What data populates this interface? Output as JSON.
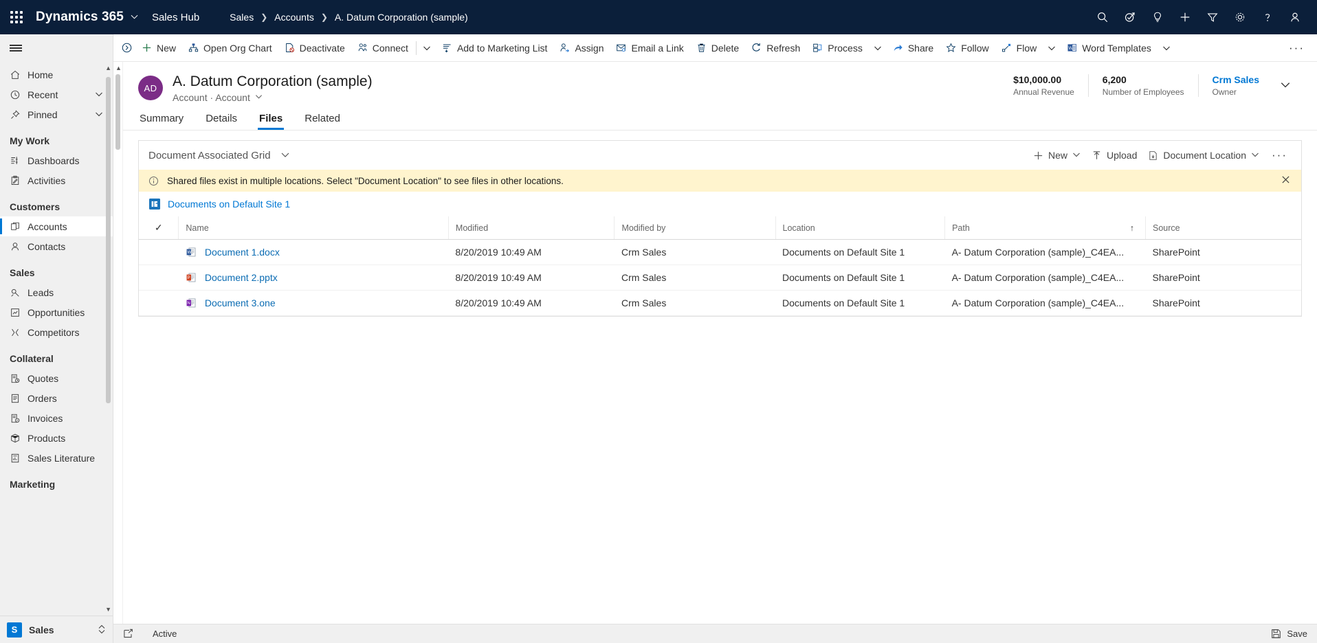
{
  "topbar": {
    "waffle_label": "app-launcher",
    "brand": "Dynamics 365",
    "app_title": "Sales Hub",
    "breadcrumbs": [
      {
        "label": "Sales"
      },
      {
        "label": "Accounts"
      },
      {
        "label": "A. Datum Corporation (sample)"
      }
    ],
    "icons": [
      {
        "name": "search-icon"
      },
      {
        "name": "assistant-icon"
      },
      {
        "name": "lightbulb-icon"
      },
      {
        "name": "quick-create-icon"
      },
      {
        "name": "filter-icon"
      },
      {
        "name": "settings-gear-icon"
      },
      {
        "name": "help-icon"
      },
      {
        "name": "user-avatar-icon"
      }
    ]
  },
  "sidebar": {
    "hamburger_label": "Site Map",
    "items": [
      {
        "label": "Home",
        "icon": "home-icon",
        "chevron": false,
        "selected": false
      },
      {
        "label": "Recent",
        "icon": "clock-icon",
        "chevron": true,
        "selected": false
      },
      {
        "label": "Pinned",
        "icon": "pin-icon",
        "chevron": true,
        "selected": false
      }
    ],
    "groups": [
      {
        "title": "My Work",
        "items": [
          {
            "label": "Dashboards",
            "icon": "dashboard-icon",
            "selected": false
          },
          {
            "label": "Activities",
            "icon": "activities-icon",
            "selected": false
          }
        ]
      },
      {
        "title": "Customers",
        "items": [
          {
            "label": "Accounts",
            "icon": "accounts-icon",
            "selected": true
          },
          {
            "label": "Contacts",
            "icon": "contacts-icon",
            "selected": false
          }
        ]
      },
      {
        "title": "Sales",
        "items": [
          {
            "label": "Leads",
            "icon": "leads-icon",
            "selected": false
          },
          {
            "label": "Opportunities",
            "icon": "opportunities-icon",
            "selected": false
          },
          {
            "label": "Competitors",
            "icon": "competitors-icon",
            "selected": false
          }
        ]
      },
      {
        "title": "Collateral",
        "items": [
          {
            "label": "Quotes",
            "icon": "quotes-icon",
            "selected": false
          },
          {
            "label": "Orders",
            "icon": "orders-icon",
            "selected": false
          },
          {
            "label": "Invoices",
            "icon": "invoices-icon",
            "selected": false
          },
          {
            "label": "Products",
            "icon": "products-icon",
            "selected": false
          },
          {
            "label": "Sales Literature",
            "icon": "sales-literature-icon",
            "selected": false
          }
        ]
      },
      {
        "title": "Marketing",
        "items": []
      }
    ],
    "area_switcher": {
      "badge": "S",
      "label": "Sales"
    }
  },
  "commandbar": {
    "collapse_icon": "collapse-ribbon-icon",
    "items": [
      {
        "label": "New",
        "icon": "plus-icon"
      },
      {
        "label": "Open Org Chart",
        "icon": "org-chart-icon"
      },
      {
        "label": "Deactivate",
        "icon": "deactivate-icon"
      },
      {
        "label": "Connect",
        "icon": "connect-icon",
        "chevron": true
      },
      {
        "label": "Add to Marketing List",
        "icon": "marketing-list-icon"
      },
      {
        "label": "Assign",
        "icon": "assign-icon"
      },
      {
        "label": "Email a Link",
        "icon": "email-link-icon"
      },
      {
        "label": "Delete",
        "icon": "trash-icon"
      },
      {
        "label": "Refresh",
        "icon": "refresh-icon"
      },
      {
        "label": "Process",
        "icon": "process-icon",
        "chevron": true
      },
      {
        "label": "Share",
        "icon": "share-icon"
      },
      {
        "label": "Follow",
        "icon": "star-icon"
      },
      {
        "label": "Flow",
        "icon": "flow-icon",
        "chevron": true
      },
      {
        "label": "Word Templates",
        "icon": "word-templates-icon",
        "chevron": true
      }
    ],
    "overflow_label": "More commands"
  },
  "record": {
    "avatar_initials": "AD",
    "title": "A. Datum Corporation (sample)",
    "subtitle": "Account · Account",
    "stats": [
      {
        "value": "$10,000.00",
        "label": "Annual Revenue",
        "link": false
      },
      {
        "value": "6,200",
        "label": "Number of Employees",
        "link": false
      },
      {
        "value": "Crm Sales",
        "label": "Owner",
        "link": true
      }
    ]
  },
  "tabs": [
    {
      "label": "Summary",
      "active": false
    },
    {
      "label": "Details",
      "active": false
    },
    {
      "label": "Files",
      "active": true
    },
    {
      "label": "Related",
      "active": false
    }
  ],
  "grid": {
    "title": "Document Associated Grid",
    "toolbar": [
      {
        "label": "New",
        "icon": "plus-icon",
        "chevron": true
      },
      {
        "label": "Upload",
        "icon": "upload-icon",
        "chevron": false
      },
      {
        "label": "Document Location",
        "icon": "document-location-icon",
        "chevron": true
      }
    ],
    "overflow_label": "More commands",
    "notification": {
      "icon": "info-icon",
      "text": "Shared files exist in multiple locations. Select \"Document Location\" to see files in other locations.",
      "close_label": "Close"
    },
    "location_link": {
      "icon": "sharepoint-icon",
      "label": "Documents on Default Site 1"
    },
    "columns": [
      {
        "key": "check",
        "label": ""
      },
      {
        "key": "name",
        "label": "Name",
        "sorted": ""
      },
      {
        "key": "modified",
        "label": "Modified",
        "sorted": ""
      },
      {
        "key": "modified_by",
        "label": "Modified by",
        "sorted": ""
      },
      {
        "key": "location",
        "label": "Location",
        "sorted": ""
      },
      {
        "key": "path",
        "label": "Path",
        "sorted": "asc"
      },
      {
        "key": "source",
        "label": "Source",
        "sorted": ""
      }
    ],
    "rows": [
      {
        "icon": "word-file-icon",
        "name": "Document 1.docx",
        "modified": "8/20/2019 10:49 AM",
        "modified_by": "Crm Sales",
        "location": "Documents on Default Site 1",
        "path": "A- Datum Corporation (sample)_C4EA...",
        "source": "SharePoint"
      },
      {
        "icon": "powerpoint-file-icon",
        "name": "Document 2.pptx",
        "modified": "8/20/2019 10:49 AM",
        "modified_by": "Crm Sales",
        "location": "Documents on Default Site 1",
        "path": "A- Datum Corporation (sample)_C4EA...",
        "source": "SharePoint"
      },
      {
        "icon": "onenote-file-icon",
        "name": "Document 3.one",
        "modified": "8/20/2019 10:49 AM",
        "modified_by": "Crm Sales",
        "location": "Documents on Default Site 1",
        "path": "A- Datum Corporation (sample)_C4EA...",
        "source": "SharePoint"
      }
    ]
  },
  "statusbar": {
    "popout_icon": "popout-icon",
    "state": "Active",
    "save_label": "Save",
    "save_icon": "save-icon"
  },
  "colors": {
    "nav_background": "#0b1f3a",
    "accent": "#0078d4",
    "link": "#0b6cb3",
    "avatar": "#7b2c86",
    "notification_background": "#fff4ce"
  }
}
